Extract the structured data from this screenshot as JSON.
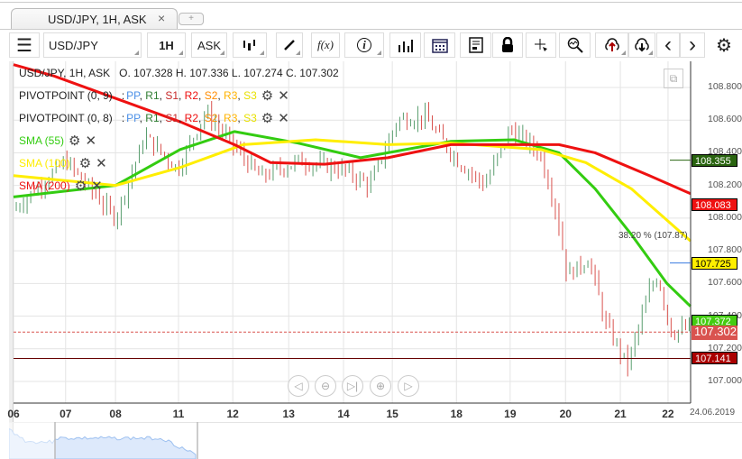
{
  "tab": {
    "title": "USD/JPY, 1H, ASK",
    "close": "×",
    "new": "+"
  },
  "toolbar": {
    "menu": "☰",
    "symbol": "USD/JPY",
    "timeframe": "1H",
    "price_type": "ASK",
    "fx": "f(x)",
    "info": "i",
    "prev": "‹",
    "next": "›"
  },
  "legend": {
    "ohlc_title": "USD/JPY, 1H, ASK",
    "ohlc": "O. 107.328 H. 107.336 L. 107.274 C. 107.302",
    "pivot1": "PIVOTPOINT (0, 9)",
    "pivot2": "PIVOTPOINT (0, 8)",
    "pivot_sep": ":",
    "pivot_items": [
      {
        "t": "PP",
        "c": "#4a8fe7"
      },
      {
        "t": "R1",
        "c": "#2e7d32"
      },
      {
        "t": "S1",
        "c": "#c62828"
      },
      {
        "t": "R2",
        "c": "#ee1111"
      },
      {
        "t": "S2",
        "c": "#ff8c00"
      },
      {
        "t": "R3",
        "c": "#ffb300"
      },
      {
        "t": "S3",
        "c": "#e8e000"
      }
    ],
    "sma55": "SMA (55)",
    "sma100": "SMA (100)",
    "sma200": "SMA (200)"
  },
  "fib_label": "38.20 % (107.87)",
  "chart_data": {
    "type": "candlestick",
    "title": "USD/JPY, 1H, ASK",
    "ylim": [
      106.87,
      108.97
    ],
    "y_ticks": [
      "108.800",
      "108.600",
      "108.400",
      "108.200",
      "108.000",
      "107.800",
      "107.600",
      "107.400",
      "107.200",
      "107.000"
    ],
    "x_ticks": [
      {
        "t": 0,
        "label": "06"
      },
      {
        "t": 0.95,
        "label": "07"
      },
      {
        "t": 1.86,
        "label": "08"
      },
      {
        "t": 3.01,
        "label": "11"
      },
      {
        "t": 4.0,
        "label": "12"
      },
      {
        "t": 5.02,
        "label": "13"
      },
      {
        "t": 6.02,
        "label": "14"
      },
      {
        "t": 6.91,
        "label": "15"
      },
      {
        "t": 8.08,
        "label": "18"
      },
      {
        "t": 9.06,
        "label": "19"
      },
      {
        "t": 10.07,
        "label": "20"
      },
      {
        "t": 11.07,
        "label": "21"
      },
      {
        "t": 11.94,
        "label": "22"
      }
    ],
    "x_end_label": "24.06.2019",
    "price_path": [
      [
        0,
        108.05
      ],
      [
        0.95,
        108.35
      ],
      [
        1.86,
        108.0
      ],
      [
        2.4,
        108.5
      ],
      [
        3.0,
        108.3
      ],
      [
        3.5,
        108.65
      ],
      [
        4.0,
        108.45
      ],
      [
        4.5,
        108.25
      ],
      [
        5.2,
        108.35
      ],
      [
        6.0,
        108.3
      ],
      [
        6.5,
        108.2
      ],
      [
        7.0,
        108.6
      ],
      [
        7.5,
        108.62
      ],
      [
        8.1,
        108.35
      ],
      [
        8.6,
        108.2
      ],
      [
        9.06,
        108.55
      ],
      [
        9.6,
        108.4
      ],
      [
        9.9,
        108.05
      ],
      [
        10.1,
        107.65
      ],
      [
        10.5,
        107.75
      ],
      [
        10.8,
        107.35
      ],
      [
        11.2,
        107.1
      ],
      [
        11.6,
        107.55
      ],
      [
        11.75,
        107.65
      ],
      [
        12.0,
        107.3
      ],
      [
        12.35,
        107.33
      ]
    ],
    "series": [
      {
        "name": "SMA (55)",
        "color": "#33cc11",
        "points": [
          [
            0,
            108.13
          ],
          [
            1.86,
            108.2
          ],
          [
            3.04,
            108.42
          ],
          [
            4.03,
            108.53
          ],
          [
            5.18,
            108.46
          ],
          [
            6.33,
            108.37
          ],
          [
            7.98,
            108.47
          ],
          [
            9.13,
            108.48
          ],
          [
            9.95,
            108.4
          ],
          [
            10.61,
            108.18
          ],
          [
            11.27,
            107.9
          ],
          [
            11.92,
            107.6
          ],
          [
            12.35,
            107.46
          ]
        ]
      },
      {
        "name": "SMA (100)",
        "color": "#ffee00",
        "points": [
          [
            0,
            108.26
          ],
          [
            1.86,
            108.2
          ],
          [
            3.04,
            108.31
          ],
          [
            4.19,
            108.45
          ],
          [
            5.51,
            108.48
          ],
          [
            6.83,
            108.45
          ],
          [
            7.98,
            108.46
          ],
          [
            9.62,
            108.42
          ],
          [
            10.44,
            108.34
          ],
          [
            11.27,
            108.18
          ],
          [
            12.35,
            107.86
          ]
        ]
      },
      {
        "name": "SMA (200)",
        "color": "#ee1111",
        "points": [
          [
            0,
            108.94
          ],
          [
            0.74,
            108.87
          ],
          [
            1.89,
            108.73
          ],
          [
            3.04,
            108.59
          ],
          [
            4.03,
            108.45
          ],
          [
            4.69,
            108.34
          ],
          [
            5.67,
            108.33
          ],
          [
            6.83,
            108.37
          ],
          [
            7.98,
            108.45
          ],
          [
            8.96,
            108.45
          ],
          [
            9.95,
            108.45
          ],
          [
            10.61,
            108.4
          ],
          [
            11.6,
            108.26
          ],
          [
            12.35,
            108.15
          ]
        ]
      }
    ],
    "price_labels": [
      {
        "value": "108.355",
        "bg": "#2a6410"
      },
      {
        "value": "108.083",
        "bg": "#ee1111"
      },
      {
        "value": "107.725",
        "bg": "#ffee00",
        "fg": "#000"
      },
      {
        "value": "107.372",
        "bg": "#44cc11"
      },
      {
        "value": "107.302",
        "bg": "#d9534f"
      },
      {
        "value": "107.141",
        "bg": "#aa0000"
      }
    ]
  }
}
